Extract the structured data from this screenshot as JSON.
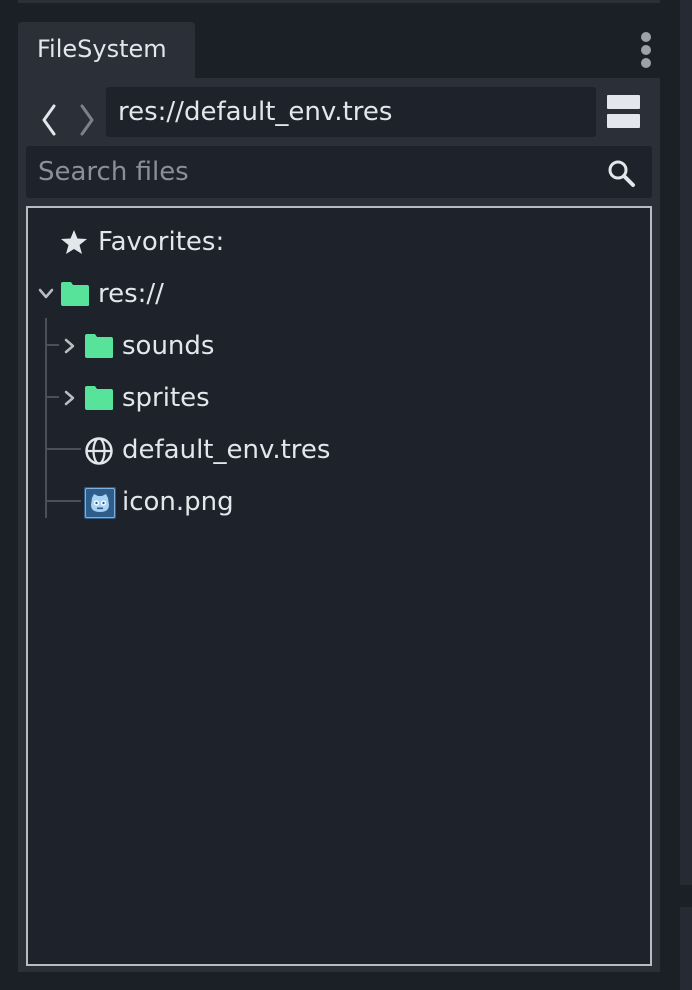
{
  "dock": {
    "tab_title": "FileSystem"
  },
  "toolbar": {
    "path": "res://default_env.tres",
    "search_placeholder": "Search files"
  },
  "tree": {
    "favorites_label": "Favorites:",
    "root_label": "res://",
    "items": [
      {
        "label": "sounds",
        "icon": "folder-icon",
        "collapsed": true
      },
      {
        "label": "sprites",
        "icon": "folder-icon",
        "collapsed": true
      },
      {
        "label": "default_env.tres",
        "icon": "environment-globe-icon"
      },
      {
        "label": "icon.png",
        "icon": "image-file-icon"
      }
    ]
  },
  "colors": {
    "folder": "#58e39b",
    "panel_bg": "#2a2f38",
    "field_bg": "#1e222a",
    "text": "#e3e6ea"
  }
}
